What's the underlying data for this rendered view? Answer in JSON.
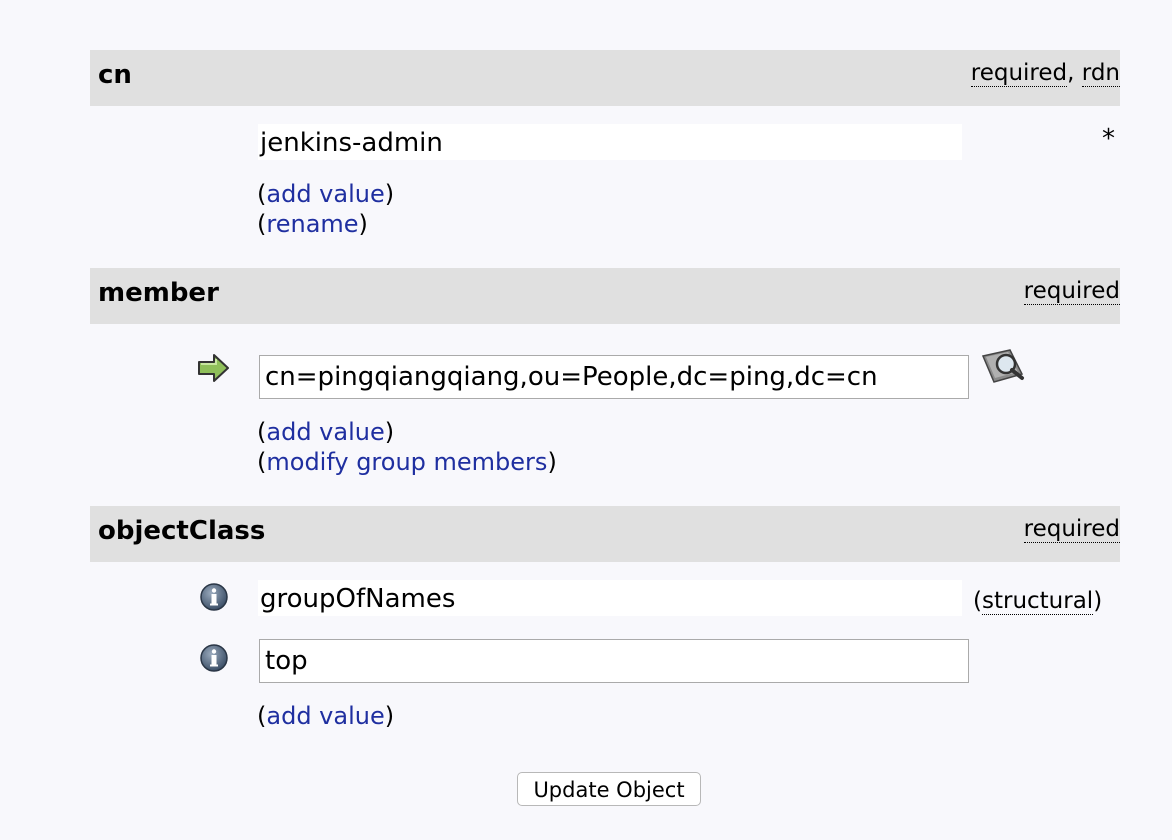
{
  "attributes": [
    {
      "name": "cn",
      "hint_parts": [
        "required",
        ", ",
        "rdn"
      ],
      "values": [
        "jenkins-admin"
      ],
      "required_marker": "*",
      "links": [
        "add value",
        "rename"
      ]
    },
    {
      "name": "member",
      "hint_parts": [
        "required"
      ],
      "values": [
        "cn=pingqiangqiang,ou=People,dc=ping,dc=cn"
      ],
      "links": [
        "add value",
        "modify group members"
      ]
    },
    {
      "name": "objectClass",
      "hint_parts": [
        "required"
      ],
      "values": [
        "groupOfNames",
        "top"
      ],
      "value_notes": [
        "structural"
      ],
      "links": [
        "add value"
      ]
    }
  ],
  "paren_open": "(",
  "paren_close": ")",
  "submit_label": "Update Object",
  "icons": {
    "go": "right-arrow-icon",
    "search": "magnifier-icon",
    "info": "info-icon"
  },
  "colors": {
    "header_bg": "#e0e0e0",
    "link": "#1f2fa0",
    "page_bg": "#f8f8fc"
  }
}
